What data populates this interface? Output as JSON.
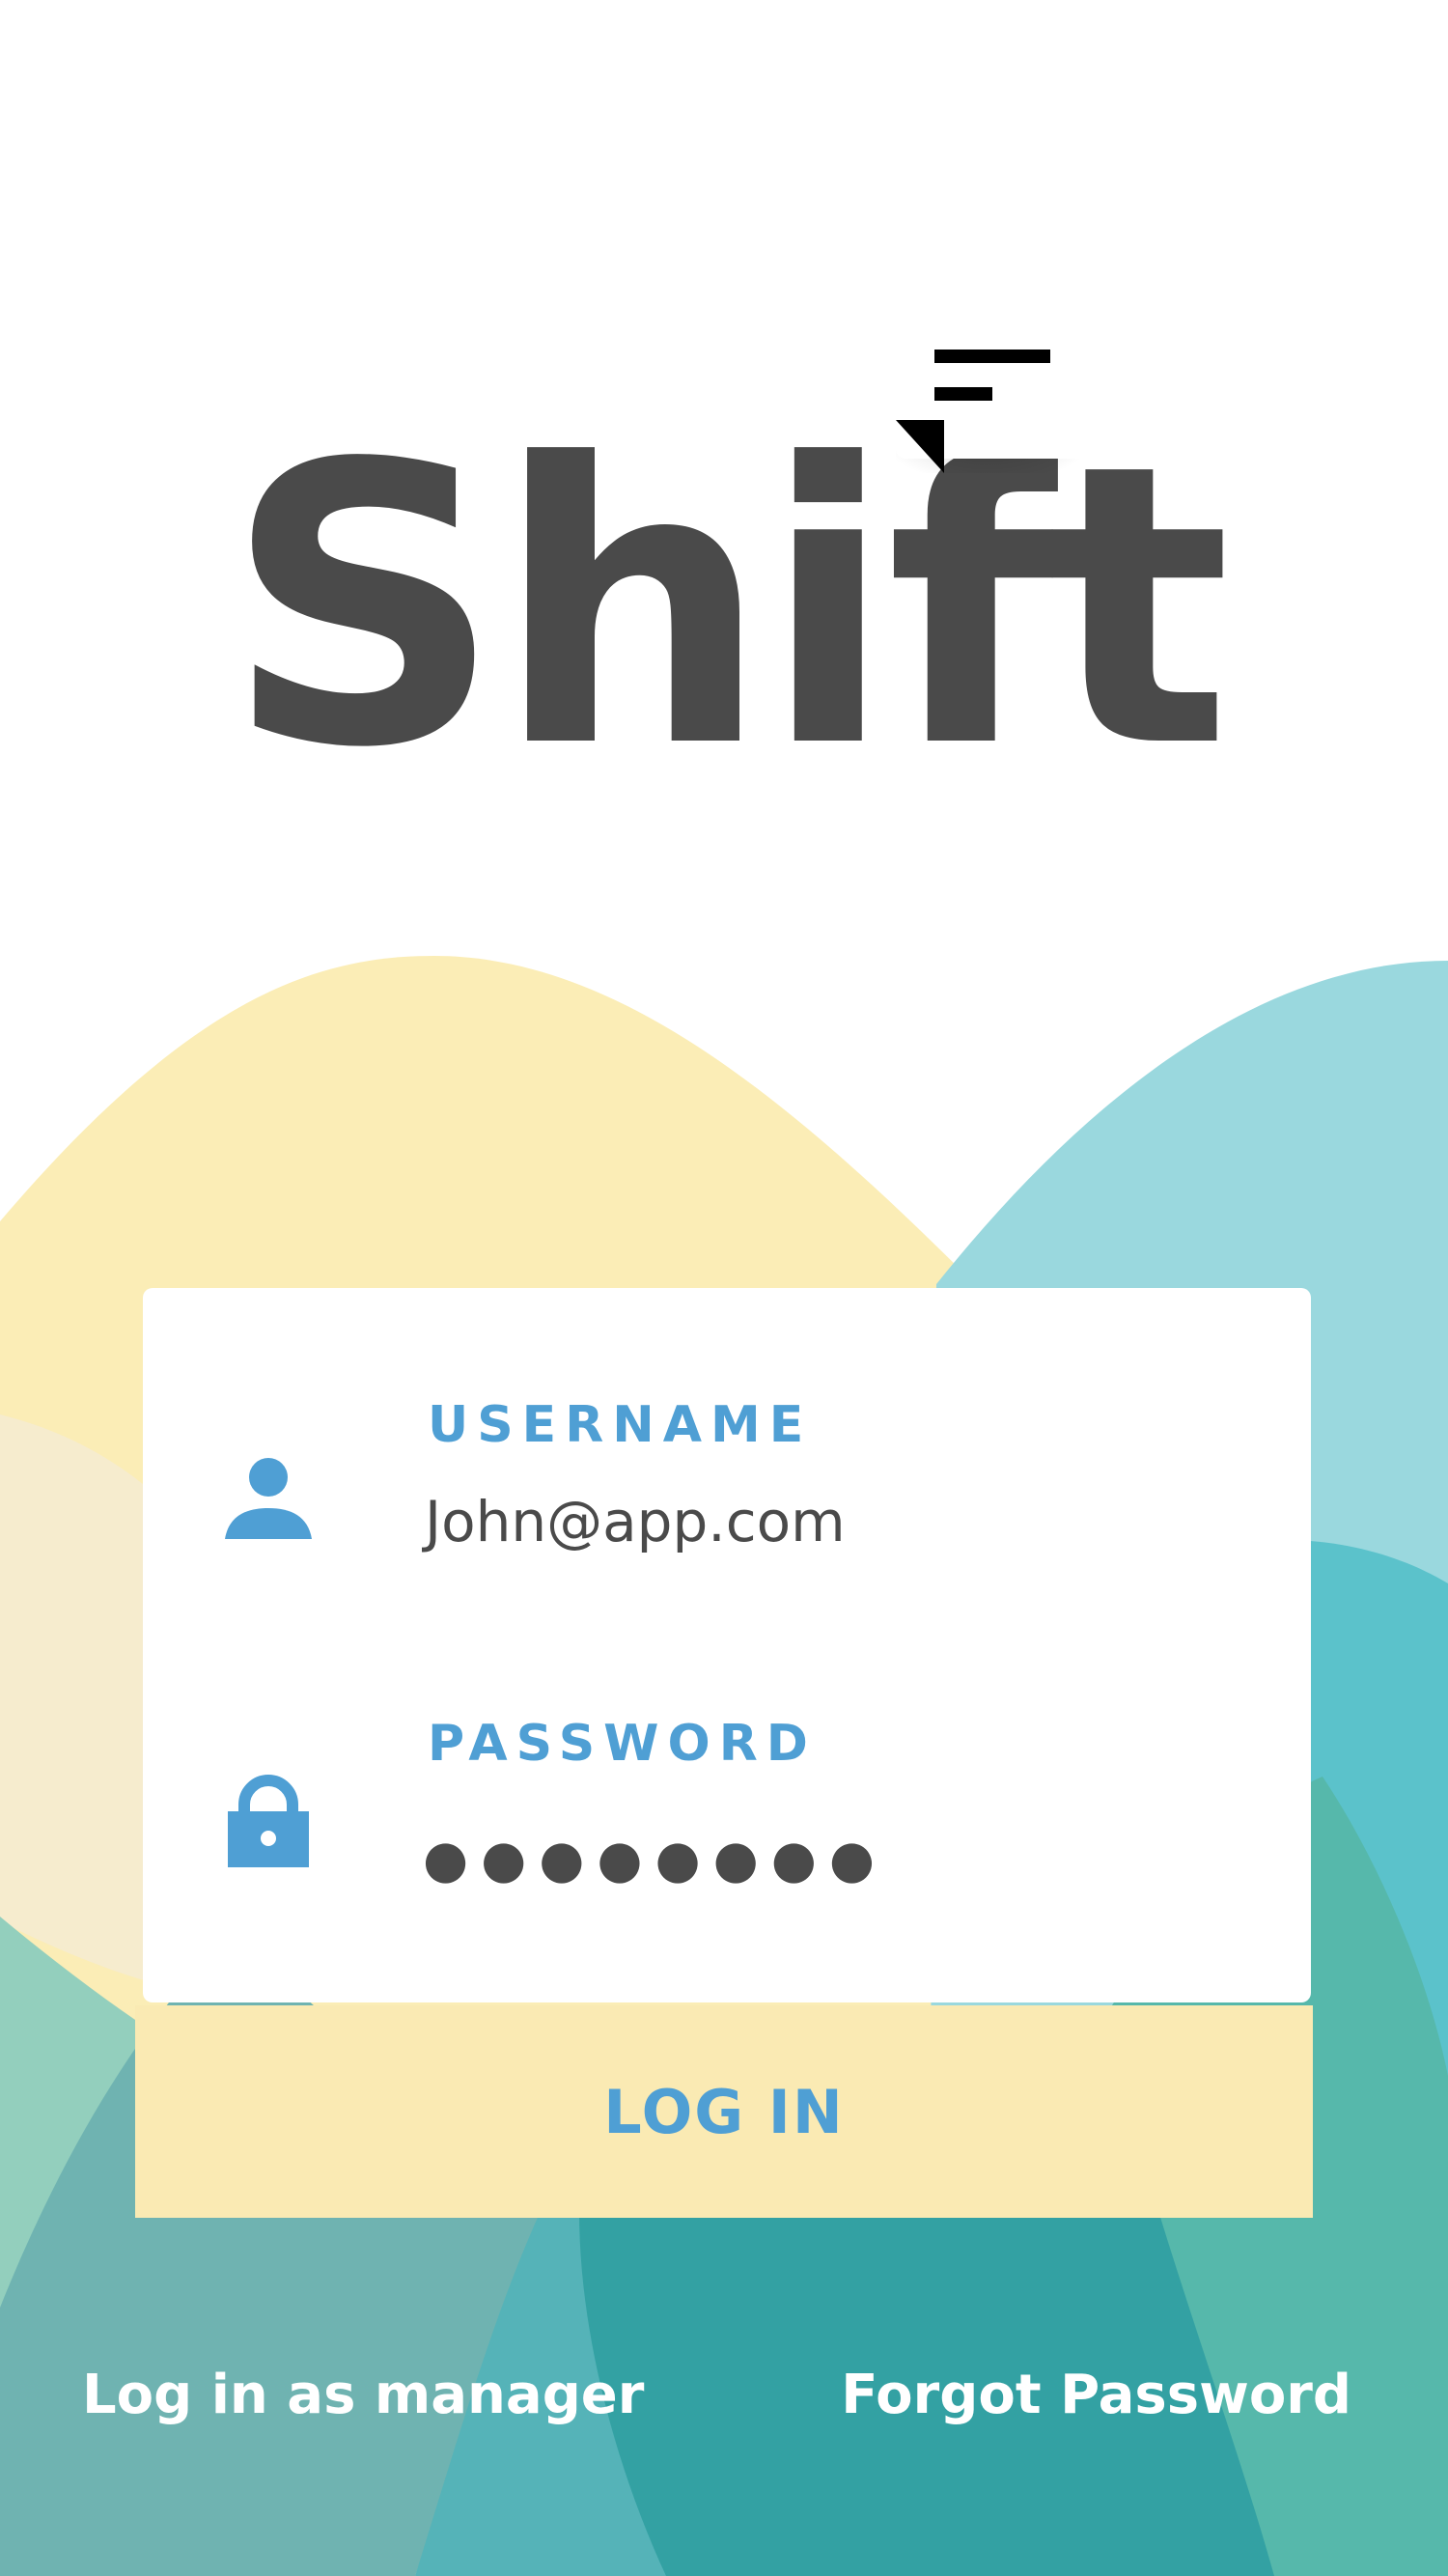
{
  "app": {
    "title": "Shift"
  },
  "menu": {
    "icon": "menu-icon"
  },
  "login_form": {
    "username": {
      "label": "USERNAME",
      "value": "John@app.com",
      "icon": "user-icon"
    },
    "password": {
      "label": "PASSWORD",
      "masked_value": "●●●●●●●●",
      "icon": "lock-icon"
    },
    "submit_label": "LOG IN"
  },
  "footer": {
    "manager_link": "Log in as manager",
    "forgot_link": "Forgot Password"
  },
  "colors": {
    "accent_blue": "#4f9fd4",
    "button_yellow": "#faeab3",
    "title_gray": "#4a4a4a",
    "wave_teal": "#33a1a3",
    "wave_light_teal": "#9ad8de"
  }
}
